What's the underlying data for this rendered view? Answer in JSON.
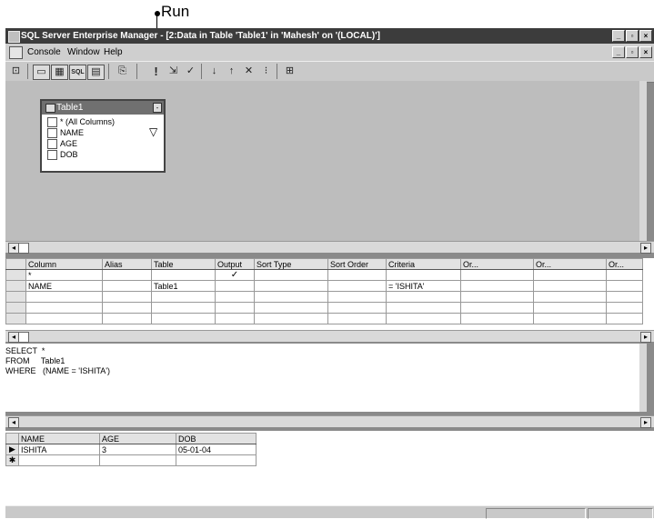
{
  "callout": {
    "label": "Run"
  },
  "window": {
    "title": "SQL Server Enterprise Manager - [2:Data in Table 'Table1' in 'Mahesh' on '(LOCAL)']",
    "controls": [
      "_",
      "▫",
      "×"
    ],
    "child_controls": [
      "_",
      "▫",
      "×"
    ]
  },
  "menu": {
    "items": [
      "Console",
      "Window",
      "Help"
    ]
  },
  "toolbar": {
    "buttons": [
      {
        "icon": "open-icon",
        "glyph": "⊡"
      },
      {
        "icon": "show-diagram-pane-icon",
        "glyph": "▭"
      },
      {
        "icon": "show-grid-pane-icon",
        "glyph": "▦"
      },
      {
        "icon": "show-sql-pane-icon",
        "glyph": "SQL"
      },
      {
        "icon": "show-results-pane-icon",
        "glyph": "▤"
      },
      {
        "icon": "change-query-type-icon",
        "glyph": "⎘"
      },
      {
        "icon": "run-icon",
        "glyph": "!"
      },
      {
        "icon": "cancel-query-icon",
        "glyph": "⇲"
      },
      {
        "icon": "verify-sql-icon",
        "glyph": "✓"
      },
      {
        "icon": "sort-ascending-icon",
        "glyph": "↓"
      },
      {
        "icon": "sort-descending-icon",
        "glyph": "↑"
      },
      {
        "icon": "remove-filter-icon",
        "glyph": "✕"
      },
      {
        "icon": "group-by-icon",
        "glyph": "⁝"
      },
      {
        "icon": "add-table-icon",
        "glyph": "⊞"
      }
    ]
  },
  "diagram": {
    "table_name": "Table1",
    "columns": [
      "* (All Columns)",
      "NAME",
      "AGE",
      "DOB"
    ],
    "filter_icon": "filter-funnel-icon"
  },
  "grid": {
    "headers": [
      "Column",
      "Alias",
      "Table",
      "Output",
      "Sort Type",
      "Sort Order",
      "Criteria",
      "Or...",
      "Or...",
      "Or..."
    ],
    "rows": [
      [
        "*",
        "",
        "",
        "✓",
        "",
        "",
        "",
        "",
        "",
        ""
      ],
      [
        "NAME",
        "",
        "Table1",
        "",
        "",
        "",
        "= 'ISHITA'",
        "",
        "",
        ""
      ],
      [
        "",
        "",
        "",
        "",
        "",
        "",
        "",
        "",
        "",
        ""
      ],
      [
        "",
        "",
        "",
        "",
        "",
        "",
        "",
        "",
        "",
        ""
      ],
      [
        "",
        "",
        "",
        "",
        "",
        "",
        "",
        "",
        "",
        ""
      ]
    ]
  },
  "sql": {
    "lines": [
      "SELECT  *",
      "FROM     Table1",
      "WHERE   (NAME = 'ISHITA')"
    ]
  },
  "results": {
    "headers": [
      "NAME",
      "AGE",
      "DOB"
    ],
    "rows": [
      [
        "ISHITA",
        "3",
        "05-01-04"
      ]
    ],
    "row_markers": [
      "▶",
      "✱"
    ]
  }
}
